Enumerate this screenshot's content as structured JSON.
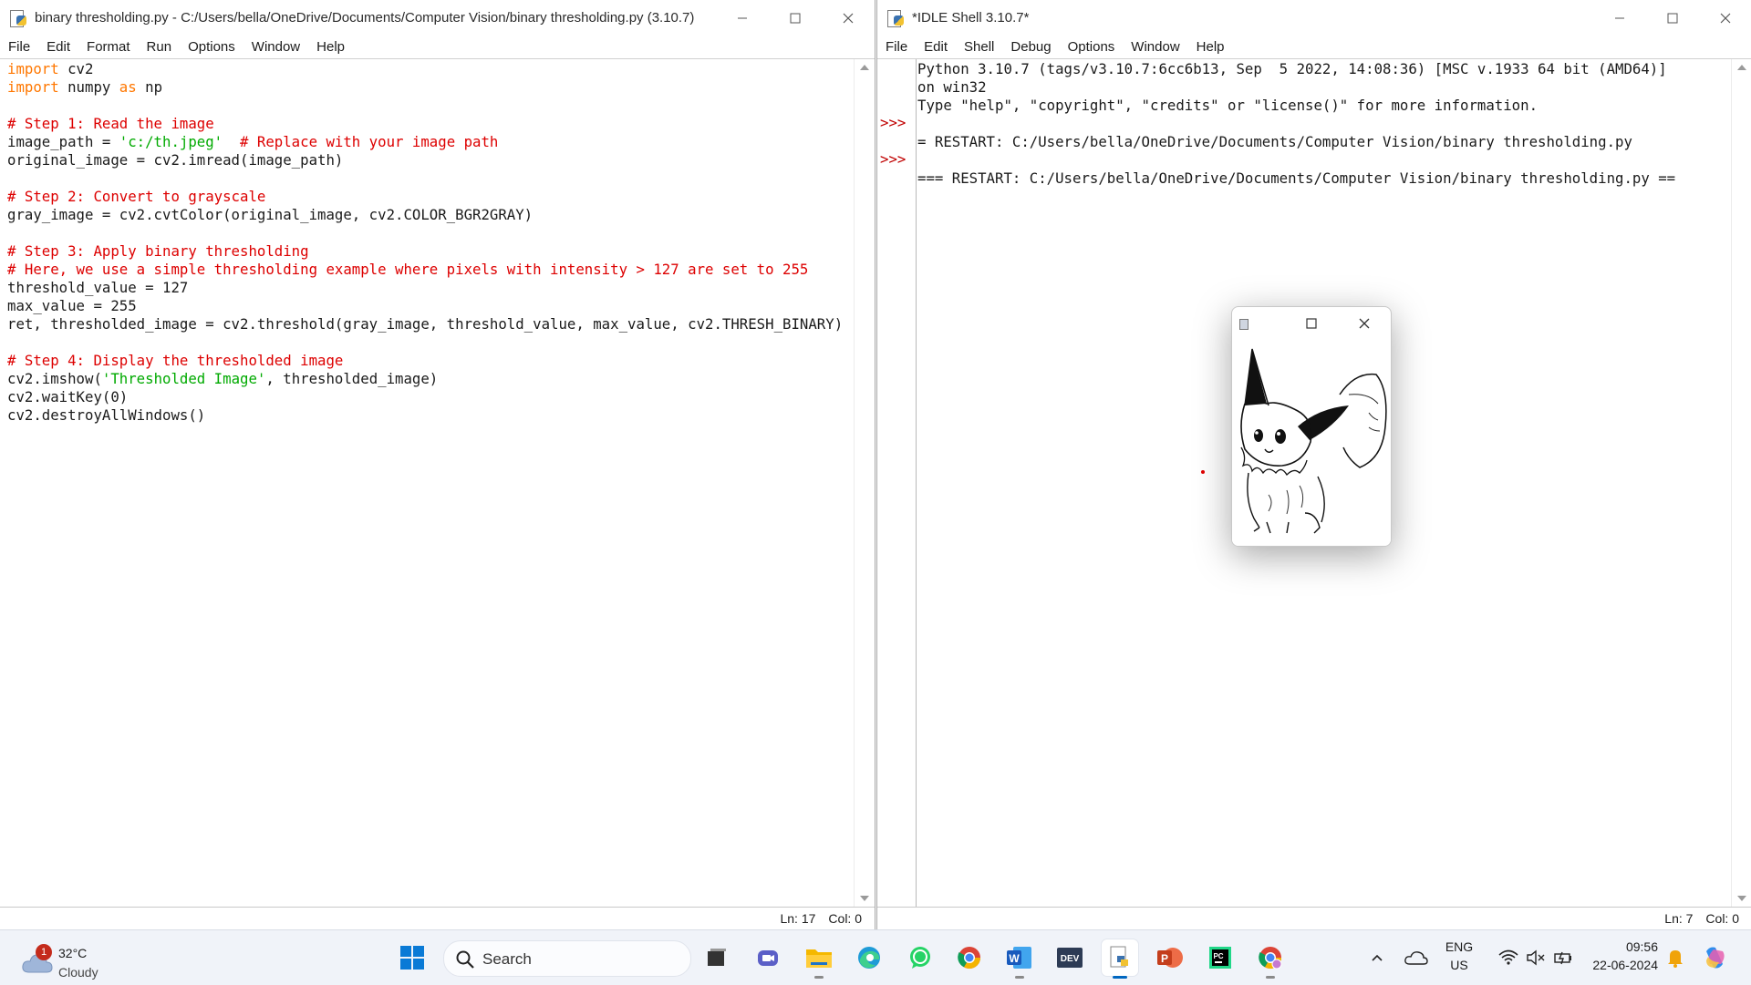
{
  "editor": {
    "title": "binary thresholding.py - C:/Users/bella/OneDrive/Documents/Computer Vision/binary thresholding.py (3.10.7)",
    "menu": [
      "File",
      "Edit",
      "Format",
      "Run",
      "Options",
      "Window",
      "Help"
    ],
    "lines": [
      [
        {
          "t": "import",
          "c": "kw"
        },
        {
          "t": " cv2",
          "c": ""
        }
      ],
      [
        {
          "t": "import",
          "c": "kw"
        },
        {
          "t": " numpy ",
          "c": ""
        },
        {
          "t": "as",
          "c": "kw"
        },
        {
          "t": " np",
          "c": ""
        }
      ],
      [],
      [
        {
          "t": "# Step 1: Read the image",
          "c": "cm"
        }
      ],
      [
        {
          "t": "image_path = ",
          "c": ""
        },
        {
          "t": "'c:/th.jpeg'",
          "c": "st"
        },
        {
          "t": "  ",
          "c": ""
        },
        {
          "t": "# Replace with your image path",
          "c": "cm"
        }
      ],
      [
        {
          "t": "original_image = cv2.imread(image_path)",
          "c": ""
        }
      ],
      [],
      [
        {
          "t": "# Step 2: Convert to grayscale",
          "c": "cm"
        }
      ],
      [
        {
          "t": "gray_image = cv2.cvtColor(original_image, cv2.COLOR_BGR2GRAY)",
          "c": ""
        }
      ],
      [],
      [
        {
          "t": "# Step 3: Apply binary thresholding",
          "c": "cm"
        }
      ],
      [
        {
          "t": "# Here, we use a simple thresholding example where pixels with intensity > 127 are set to 255",
          "c": "cm"
        }
      ],
      [
        {
          "t": "threshold_value = 127",
          "c": ""
        }
      ],
      [
        {
          "t": "max_value = 255",
          "c": ""
        }
      ],
      [
        {
          "t": "ret, thresholded_image = cv2.threshold(gray_image, threshold_value, max_value, cv2.THRESH_BINARY)",
          "c": ""
        }
      ],
      [],
      [
        {
          "t": "# Step 4: Display the thresholded image",
          "c": "cm"
        }
      ],
      [
        {
          "t": "cv2.imshow(",
          "c": ""
        },
        {
          "t": "'Thresholded Image'",
          "c": "st"
        },
        {
          "t": ", thresholded_image)",
          "c": ""
        }
      ],
      [
        {
          "t": "cv2.waitKey(0)",
          "c": ""
        }
      ],
      [
        {
          "t": "cv2.destroyAllWindows()",
          "c": ""
        }
      ]
    ],
    "status_ln": "Ln: 17",
    "status_col": "Col: 0"
  },
  "shell": {
    "title": "*IDLE Shell 3.10.7*",
    "menu": [
      "File",
      "Edit",
      "Shell",
      "Debug",
      "Options",
      "Window",
      "Help"
    ],
    "prompts": [
      "",
      "",
      "",
      ">>>",
      "",
      ">>>"
    ],
    "lines": [
      "Python 3.10.7 (tags/v3.10.7:6cc6b13, Sep  5 2022, 14:08:36) [MSC v.1933 64 bit (AMD64)]",
      "on win32",
      "Type \"help\", \"copyright\", \"credits\" or \"license()\" for more information.",
      "",
      "= RESTART: C:/Users/bella/OneDrive/Documents/Computer Vision/binary thresholding.py",
      "",
      "=== RESTART: C:/Users/bella/OneDrive/Documents/Computer Vision/binary thresholding.py =="
    ],
    "status_ln": "Ln: 7",
    "status_col": "Col: 0"
  },
  "taskbar": {
    "weather_badge": "1",
    "temperature": "32°C",
    "condition": "Cloudy",
    "search_label": "Search",
    "lang_top": "ENG",
    "lang_bottom": "US",
    "time": "09:56",
    "date": "22-06-2024",
    "apps": [
      "windows-start",
      "task-view",
      "meet",
      "file-explorer",
      "edge",
      "whatsapp",
      "chrome",
      "word",
      "dev-home",
      "python-idle",
      "powerpoint",
      "pycharm",
      "chrome-profile"
    ]
  }
}
